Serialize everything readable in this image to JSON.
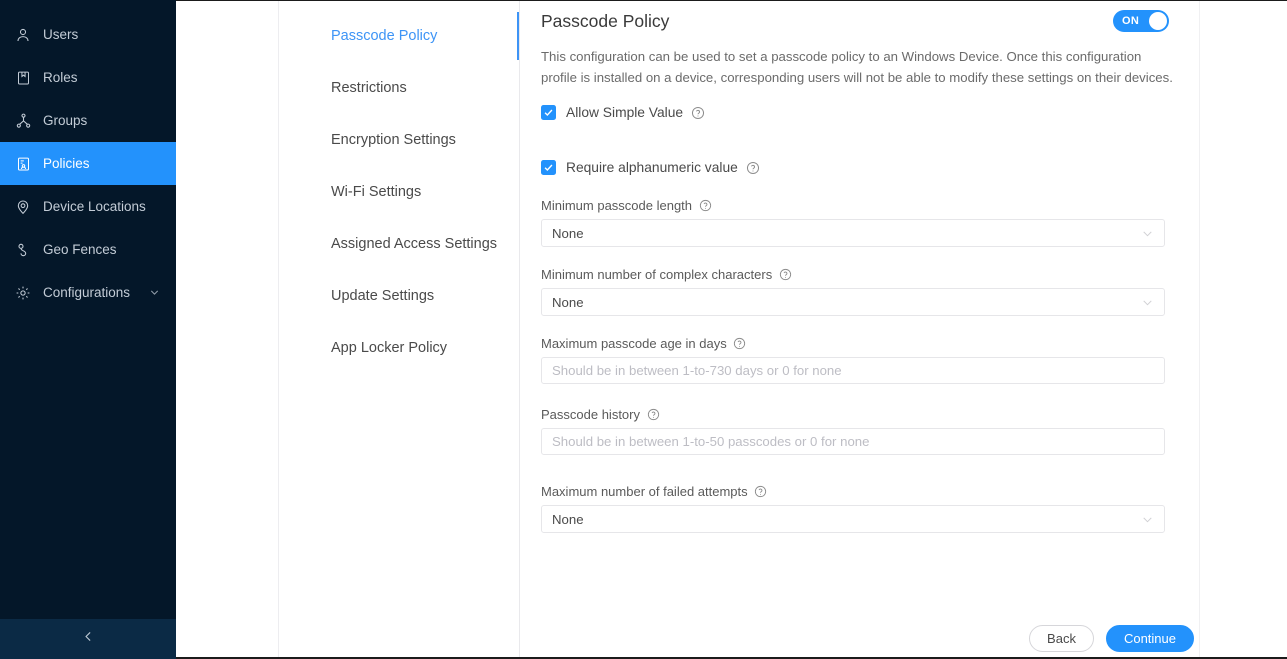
{
  "sidebar": {
    "items": [
      {
        "label": "Users",
        "icon": "user-icon",
        "active": false
      },
      {
        "label": "Roles",
        "icon": "roles-icon",
        "active": false
      },
      {
        "label": "Groups",
        "icon": "groups-icon",
        "active": false
      },
      {
        "label": "Policies",
        "icon": "policies-icon",
        "active": true
      },
      {
        "label": "Device Locations",
        "icon": "location-pin-icon",
        "active": false
      },
      {
        "label": "Geo Fences",
        "icon": "geo-fence-icon",
        "active": false
      },
      {
        "label": "Configurations",
        "icon": "gear-icon",
        "active": false,
        "expandable": true
      }
    ],
    "collapse_icon": "chevron-left-icon",
    "active_color": "#2392fc",
    "background_color": "#041729"
  },
  "subnav": {
    "items": [
      {
        "label": "Passcode Policy",
        "active": true
      },
      {
        "label": "Restrictions",
        "active": false
      },
      {
        "label": "Encryption Settings",
        "active": false
      },
      {
        "label": "Wi-Fi Settings",
        "active": false
      },
      {
        "label": "Assigned Access Settings",
        "active": false
      },
      {
        "label": "Update Settings",
        "active": false
      },
      {
        "label": "App Locker Policy",
        "active": false
      }
    ],
    "active_color": "#3d94f6"
  },
  "panel": {
    "title": "Passcode Policy",
    "toggle": {
      "label": "ON",
      "state": "on",
      "color": "#2392fc"
    },
    "description": "This configuration can be used to set a passcode policy to an Windows Device. Once this configuration profile is installed on a device, corresponding users will not be able to modify these settings on their devices.",
    "checkboxes": [
      {
        "label": "Allow Simple Value",
        "checked": true,
        "help_icon": "help-circle-icon"
      },
      {
        "label": "Require alphanumeric value",
        "checked": true,
        "help_icon": "help-circle-icon"
      }
    ],
    "fields": [
      {
        "label": "Minimum passcode length",
        "type": "select",
        "value": "None",
        "help_icon": "help-circle-icon",
        "chevron": "chevron-down-icon"
      },
      {
        "label": "Minimum number of complex characters",
        "type": "select",
        "value": "None",
        "help_icon": "help-circle-icon",
        "chevron": "chevron-down-icon"
      },
      {
        "label": "Maximum passcode age in days",
        "type": "text",
        "value": "",
        "placeholder": "Should be in between 1-to-730 days or 0 for none",
        "help_icon": "help-circle-icon"
      },
      {
        "label": "Passcode history",
        "type": "text",
        "value": "",
        "placeholder": "Should be in between 1-to-50 passcodes or 0 for none",
        "help_icon": "help-circle-icon"
      },
      {
        "label": "Maximum number of failed attempts",
        "type": "select",
        "value": "None",
        "help_icon": "help-circle-icon",
        "chevron": "chevron-down-icon"
      }
    ]
  },
  "footer": {
    "back_label": "Back",
    "continue_label": "Continue",
    "primary_color": "#2392fc"
  }
}
